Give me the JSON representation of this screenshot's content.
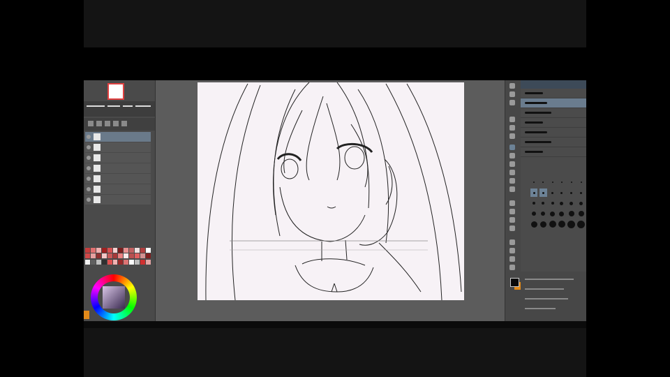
{
  "app": {
    "left_panel": {
      "layers": [
        {
          "label": "",
          "selected": true
        },
        {
          "label": "",
          "selected": false
        },
        {
          "label": "",
          "selected": false
        },
        {
          "label": "",
          "selected": false
        },
        {
          "label": "",
          "selected": false
        },
        {
          "label": "",
          "selected": false
        },
        {
          "label": "",
          "selected": false
        }
      ],
      "swatch_colors": [
        "#c43c3c",
        "#e07070",
        "#f0b0b0",
        "#a02020",
        "#d85050",
        "#f4d0d0",
        "#7a1e1e",
        "#e89090",
        "#c06060",
        "#f0e0e0",
        "#b04040",
        "#ffffff",
        "#d04848",
        "#e8a0a0",
        "#903030",
        "#f6c6c6",
        "#c85858",
        "#a83838",
        "#ec8080",
        "#ffe8e8",
        "#b85050",
        "#e06060",
        "#d49090",
        "#802020",
        "#f0f0f0",
        "#606060",
        "#c0c0c0",
        "#303030",
        "#e05050",
        "#f2b2b2",
        "#9a2a2a",
        "#dc7474",
        "#fafafa",
        "#bbbbbb",
        "#d03030",
        "#e4a4a4"
      ],
      "color_wheel": {
        "fg": "#0a0a0a",
        "bg": "#e28a1a"
      }
    },
    "right_panel": {
      "brushes": [
        {
          "name": "",
          "selected": false
        },
        {
          "name": "",
          "selected": true
        },
        {
          "name": "",
          "selected": false
        },
        {
          "name": "",
          "selected": false
        },
        {
          "name": "",
          "selected": false
        },
        {
          "name": "",
          "selected": false
        },
        {
          "name": "",
          "selected": false
        }
      ],
      "size_dot_levels": [
        1,
        1,
        1,
        1,
        1,
        1,
        2,
        2,
        2,
        2,
        2,
        2,
        3,
        3,
        3,
        4,
        4,
        4,
        5,
        5,
        6,
        6,
        7,
        7,
        8,
        8,
        9,
        9,
        10,
        10
      ]
    },
    "accent_color": "#6a7c8e"
  }
}
